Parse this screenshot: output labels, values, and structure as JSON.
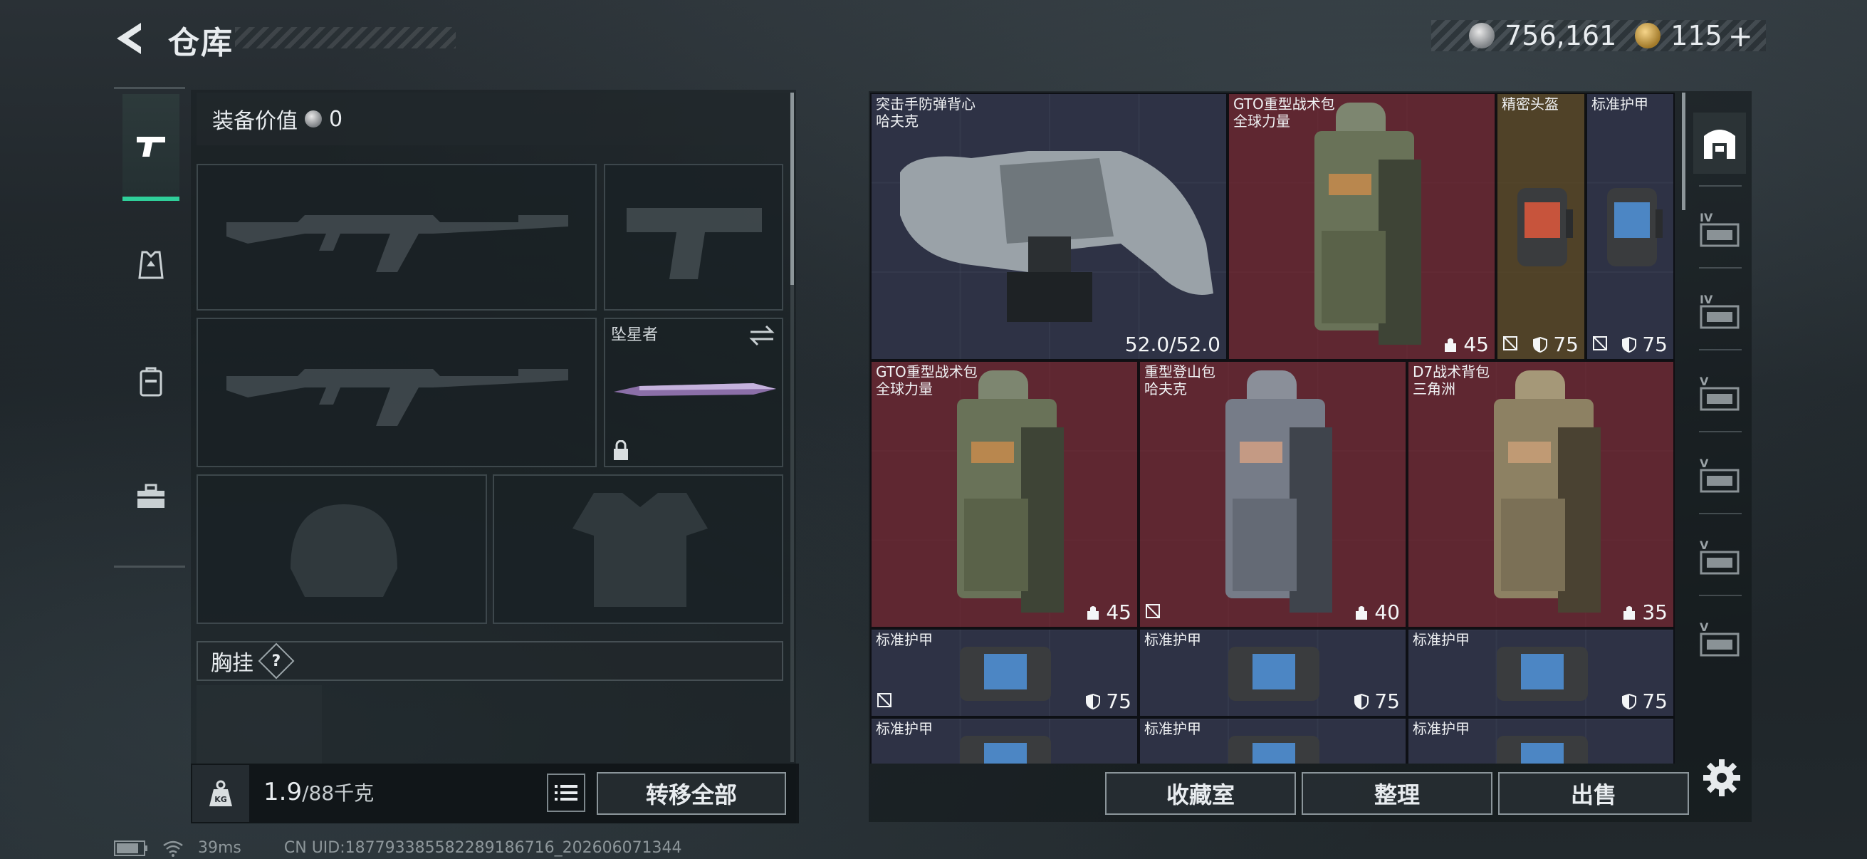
{
  "header": {
    "title": "仓库",
    "currency_silver": "756,161",
    "currency_gold": "115",
    "gold_add": "+"
  },
  "loadout": {
    "equip_value_label": "装备价值",
    "equip_value": "0",
    "melee_slot_name": "坠星者",
    "chest_rig_label": "胸挂",
    "chest_rig_help": "?"
  },
  "weight": {
    "current": "1.9",
    "max_unit": "/88千克",
    "kg_badge": "KG",
    "transfer_all": "转移全部"
  },
  "stash": {
    "items": [
      {
        "line1": "突击手防弹背心",
        "line2": "哈夫克",
        "value": "52.0/52.0"
      },
      {
        "line1": "GTO重型战术包",
        "line2": "全球力量",
        "value": "45"
      },
      {
        "line1": "精密头盔",
        "line2": "",
        "value": "75"
      },
      {
        "line1": "标准护甲",
        "line2": "",
        "value": "75"
      },
      {
        "line1": "GTO重型战术包",
        "line2": "全球力量",
        "value": "45"
      },
      {
        "line1": "重型登山包",
        "line2": "哈夫克",
        "value": "40"
      },
      {
        "line1": "D7战术背包",
        "line2": "三角洲",
        "value": "35"
      },
      {
        "line1": "标准护甲",
        "line2": "",
        "value": "75"
      },
      {
        "line1": "标准护甲",
        "line2": "",
        "value": "75"
      },
      {
        "line1": "标准护甲",
        "line2": "",
        "value": "75"
      },
      {
        "line1": "标准护甲",
        "line2": "",
        "value": ""
      },
      {
        "line1": "标准护甲",
        "line2": "",
        "value": ""
      },
      {
        "line1": "标准护甲",
        "line2": "",
        "value": ""
      }
    ],
    "filters": [
      "IV",
      "IV",
      "V",
      "V",
      "V",
      "V"
    ]
  },
  "bottom_buttons": {
    "collection": "收藏室",
    "organize": "整理",
    "sell": "出售"
  },
  "status_bar": {
    "ping": "39ms",
    "uid": "CN UID:187793385582289186716_202606071344"
  },
  "colors": {
    "accent_green": "#2fcf9a",
    "rarity_red": "#70262f",
    "rarity_gold": "#584626",
    "rarity_blue": "#343850"
  }
}
